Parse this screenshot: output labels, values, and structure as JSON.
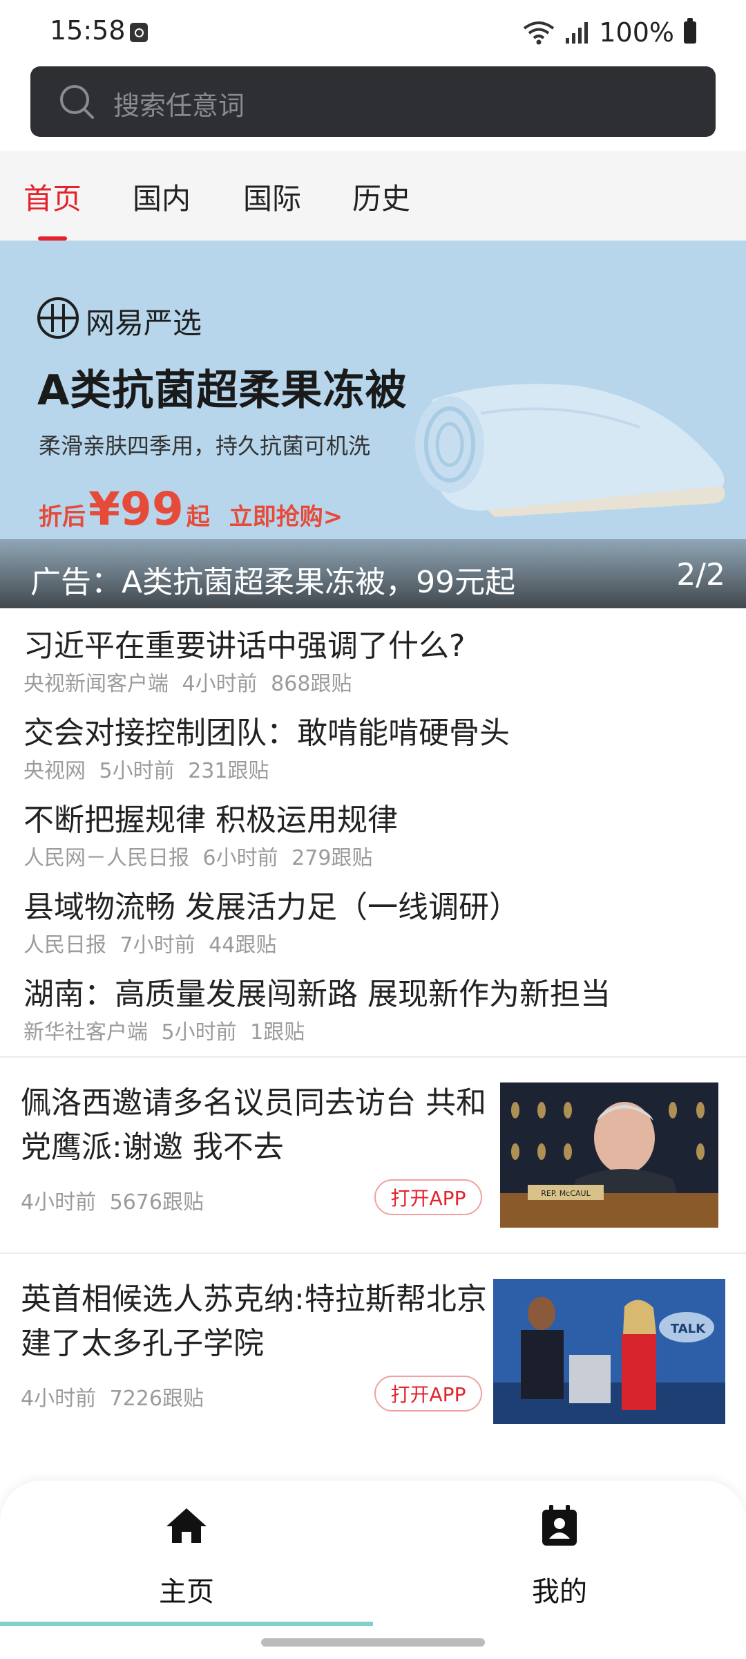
{
  "status_bar": {
    "time": "15:58",
    "battery": "100%",
    "icons": [
      "alarm-icon",
      "wifi-icon",
      "signal-icon",
      "battery-icon"
    ]
  },
  "search": {
    "placeholder": "搜索任意词"
  },
  "tabs": [
    {
      "label": "首页",
      "active": true
    },
    {
      "label": "国内",
      "active": false
    },
    {
      "label": "国际",
      "active": false
    },
    {
      "label": "历史",
      "active": false
    }
  ],
  "banner": {
    "brand": "网易严选",
    "headline": "A类抗菌超柔果冻被",
    "subline": "柔滑亲肤四季用，持久抗菌可机洗",
    "price_prefix": "折后",
    "price": "¥99",
    "price_suffix": "起",
    "cta": "立即抢购>",
    "caption": "广告：A类抗菌超柔果冻被，99元起",
    "pager": "2/2"
  },
  "headlines": [
    {
      "title": "习近平在重要讲话中强调了什么?",
      "meta": "央视新闻客户端 4小时前 868跟贴"
    },
    {
      "title": "交会对接控制团队：敢啃能啃硬骨头",
      "meta": "央视网 5小时前 231跟贴"
    },
    {
      "title": "不断把握规律 积极运用规律",
      "meta": "人民网－人民日报 6小时前 279跟贴"
    },
    {
      "title": "县域物流畅 发展活力足（一线调研）",
      "meta": "人民日报 7小时前 44跟贴"
    },
    {
      "title": "湖南：高质量发展闯新路 展现新作为新担当",
      "meta": "新华社客户端 5小时前 1跟贴"
    }
  ],
  "news_cards": [
    {
      "title": "佩洛西邀请多名议员同去访台 共和党鹰派:谢邀 我不去",
      "meta": "4小时前 5676跟贴",
      "button": "打开APP",
      "image_text": "REP. McCAUL"
    },
    {
      "title": "英首相候选人苏克纳:特拉斯帮北京建了太多孔子学院",
      "meta": "4小时前 7226跟贴",
      "button": "打开APP",
      "image_text": "TALK"
    }
  ],
  "bottom_nav": [
    {
      "label": "主页",
      "icon": "home-icon",
      "active": true
    },
    {
      "label": "我的",
      "icon": "contact-icon",
      "active": false
    }
  ],
  "colors": {
    "accent": "#e4222c",
    "search_bg": "#2e2f33",
    "banner_bg": "#b7d6ec",
    "nav_active_underline": "#7fd0c9"
  }
}
